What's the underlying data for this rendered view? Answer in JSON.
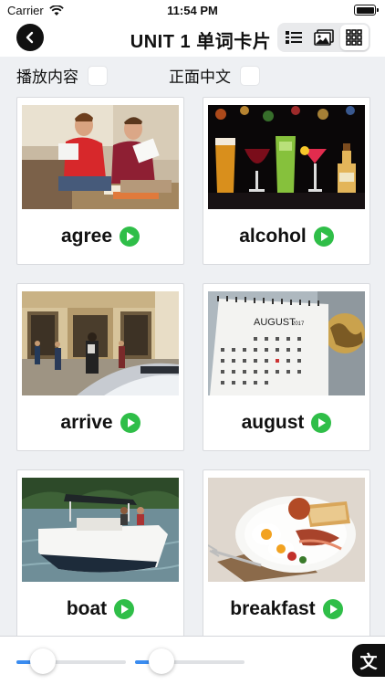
{
  "status_bar": {
    "carrier": "Carrier",
    "time": "11:54 PM",
    "battery_level": 1.0
  },
  "nav": {
    "title": "UNIT 1 单词卡片",
    "back_icon": "chevron-left-icon"
  },
  "view_modes": [
    {
      "name": "list-view",
      "icon": "list-icon",
      "active": false
    },
    {
      "name": "image-view",
      "icon": "image-icon",
      "active": false
    },
    {
      "name": "grid-view",
      "icon": "grid-icon",
      "active": true
    }
  ],
  "options": {
    "play_content_label": "播放内容",
    "front_chinese_label": "正面中文"
  },
  "cards": [
    {
      "word": "agree"
    },
    {
      "word": "alcohol"
    },
    {
      "word": "arrive"
    },
    {
      "word": "august"
    },
    {
      "word": "boat"
    },
    {
      "word": "breakfast"
    }
  ],
  "calendar_image_text": {
    "month": "AUGUST",
    "year": "2017"
  },
  "sliders": [
    {
      "value": 0.24
    },
    {
      "value": 0.24
    }
  ],
  "text_button_label": "文",
  "colors": {
    "accent_green": "#2fbe48",
    "slider_blue": "#3a8cf0"
  }
}
